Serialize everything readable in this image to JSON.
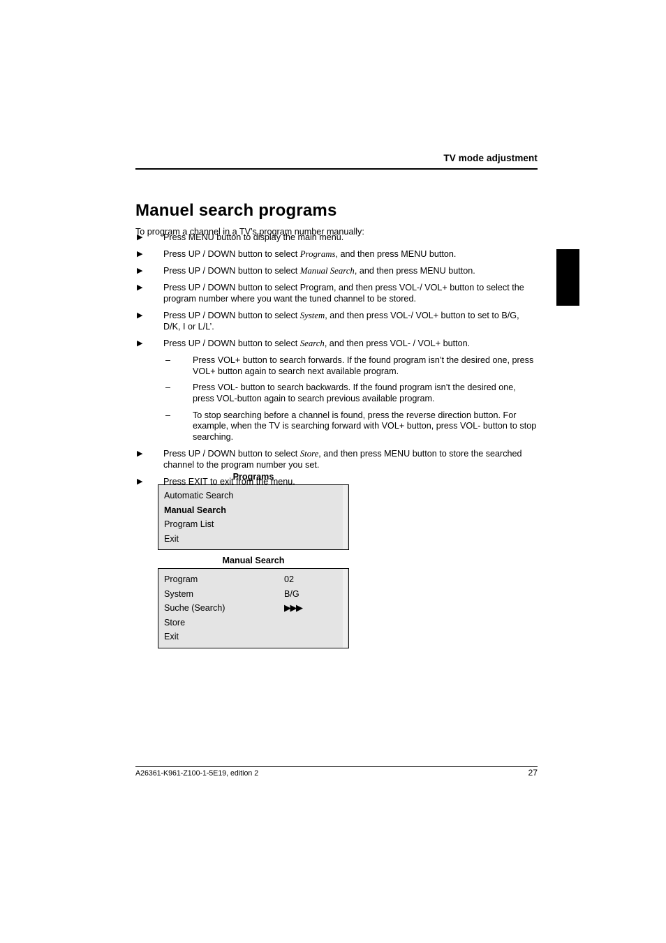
{
  "header": {
    "running_title": "TV mode adjustment"
  },
  "title": "Manuel search programs",
  "intro": "To program a channel in a TV’s program number manually:",
  "bullet_glyph": "▶",
  "dash_glyph": "–",
  "steps": [
    {
      "parts": [
        {
          "text": "Press MENU button to display the main menu.",
          "style": "normal"
        }
      ]
    },
    {
      "parts": [
        {
          "text": "Press UP / DOWN button to select ",
          "style": "normal"
        },
        {
          "text": "Programs",
          "style": "italic"
        },
        {
          "text": ", and then press MENU button.",
          "style": "normal"
        }
      ]
    },
    {
      "parts": [
        {
          "text": "Press UP / DOWN button to select ",
          "style": "normal"
        },
        {
          "text": "Manual Search",
          "style": "italic"
        },
        {
          "text": ", and then press MENU button.",
          "style": "normal"
        }
      ]
    },
    {
      "parts": [
        {
          "text": "Press UP / DOWN button to select Program, and then press VOL-/ VOL+ button to select the program number where you want the tuned channel to be stored.",
          "style": "normal"
        }
      ]
    },
    {
      "parts": [
        {
          "text": "Press UP / DOWN button to select ",
          "style": "normal"
        },
        {
          "text": "System",
          "style": "italic"
        },
        {
          "text": ", and then press VOL-/ VOL+ button to set to B/G, D/K, I or L/L’.",
          "style": "normal"
        }
      ]
    },
    {
      "parts": [
        {
          "text": "Press UP / DOWN button to select ",
          "style": "normal"
        },
        {
          "text": "Search",
          "style": "italic"
        },
        {
          "text": ", and then press VOL- / VOL+ button.",
          "style": "normal"
        }
      ],
      "substeps": [
        "Press VOL+ button to search forwards. If the found program isn’t the desired one, press VOL+ button again to search next available program.",
        "Press VOL- button to search backwards. If the found program isn’t the desired one, press VOL-button again to search previous available program.",
        "To stop searching before a channel is found, press the reverse direction button. For example, when the TV is searching forward with VOL+ button, press VOL- button to stop searching."
      ]
    },
    {
      "parts": [
        {
          "text": "Press UP / DOWN button to select ",
          "style": "normal"
        },
        {
          "text": "Store",
          "style": "italic"
        },
        {
          "text": ", and then press MENU button to store the searched channel to the program number you set.",
          "style": "normal"
        }
      ]
    },
    {
      "parts": [
        {
          "text": "Press EXIT to exit from the menu.",
          "style": "normal"
        }
      ]
    }
  ],
  "menus": [
    {
      "title": "Programs",
      "rows": [
        {
          "label": "Automatic Search",
          "value": "",
          "selected": false
        },
        {
          "label": "Manual Search",
          "value": "",
          "selected": true
        },
        {
          "label": "Program List",
          "value": "",
          "selected": false
        },
        {
          "label": "Exit",
          "value": "",
          "selected": false
        }
      ]
    },
    {
      "title": "Manual Search",
      "rows": [
        {
          "label": "Program",
          "value": "02",
          "selected": false
        },
        {
          "label": "System",
          "value": "B/G",
          "selected": false
        },
        {
          "label": "Suche (Search)",
          "value": "▶▶▶",
          "selected": false,
          "value_is_arrows": true
        },
        {
          "label": "Store",
          "value": "",
          "selected": false
        },
        {
          "label": "Exit",
          "value": "",
          "selected": false
        }
      ]
    }
  ],
  "footer": {
    "document_id": "A26361-K961-Z100-1-5E19, edition 2",
    "page_number": "27"
  },
  "colors": {
    "menu_fill": "#e4e4e4",
    "rule": "#000000",
    "thumb_tab": "#000000"
  }
}
